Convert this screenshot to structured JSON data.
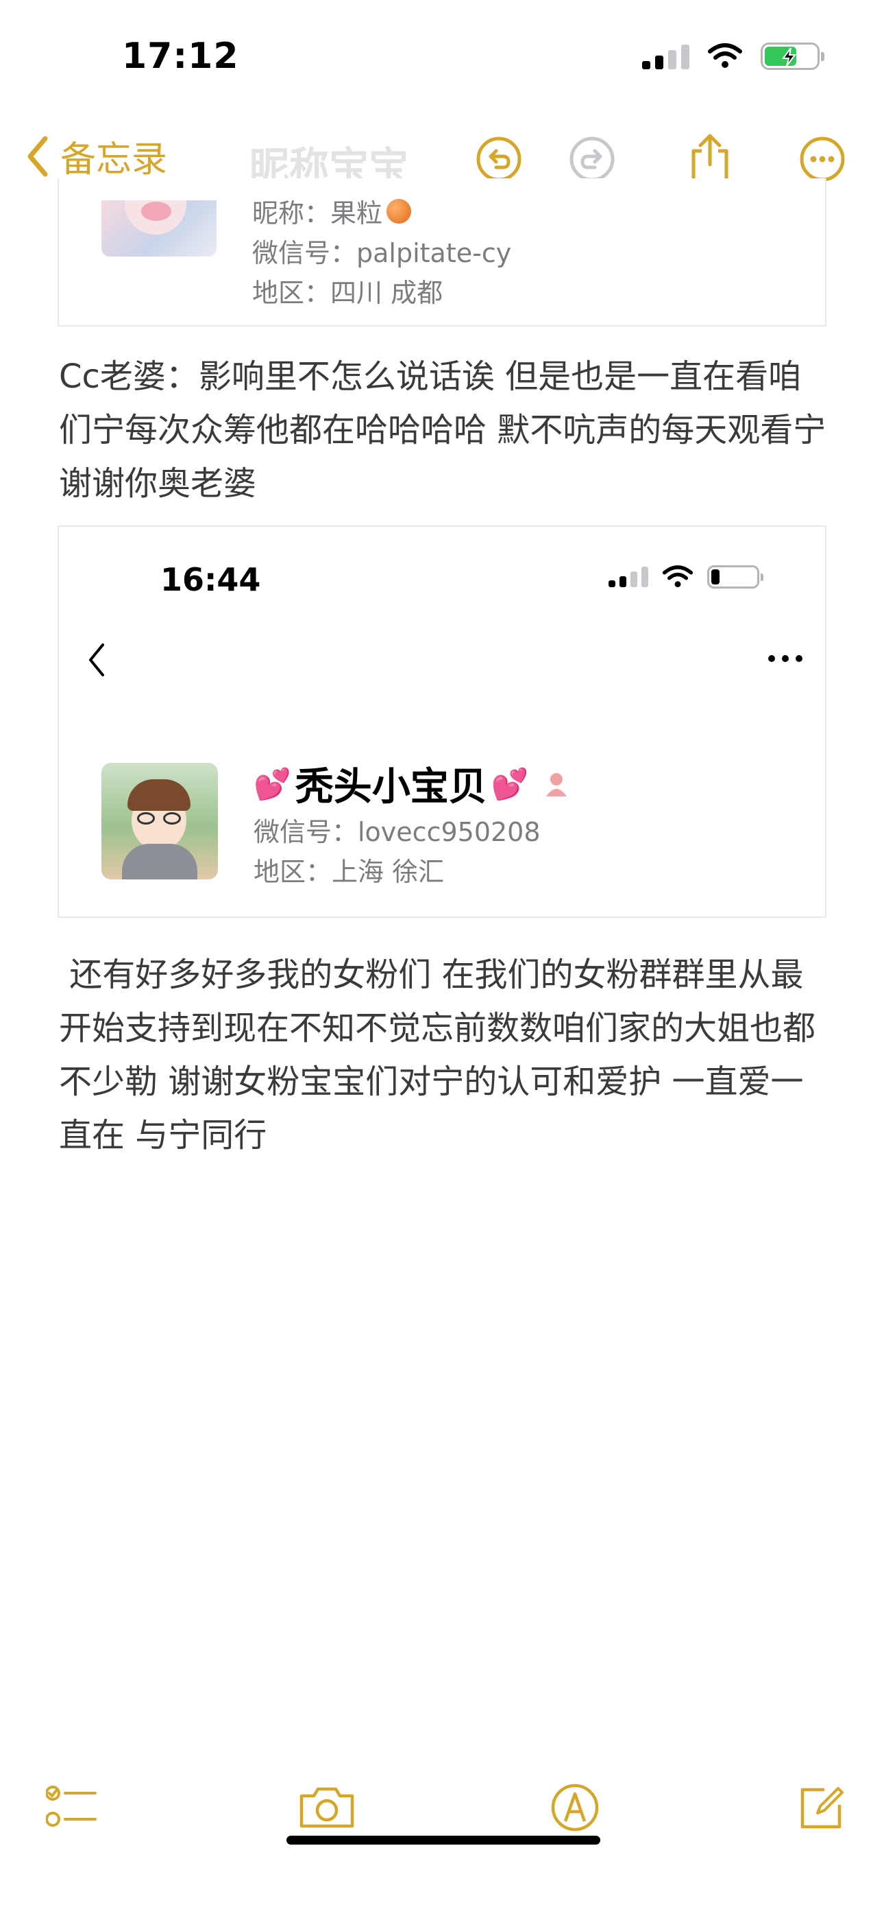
{
  "status_bar": {
    "time": "17:12"
  },
  "nav": {
    "back_label": "备忘录",
    "ghost_title": "昵称宝宝",
    "accent_color": "#d6a62a"
  },
  "card1": {
    "nickname": "昵称：果粒",
    "wechat": "微信号：palpitate-cy",
    "region": "地区：四川 成都"
  },
  "paragraph1": "Cc老婆：影响里不怎么说话诶 但是也是一直在看咱们宁每次众筹他都在哈哈哈哈 默不吭声的每天观看宁 谢谢你奥老婆",
  "card2": {
    "time": "16:44",
    "name": "秃头小宝贝",
    "wechat": "微信号：lovecc950208",
    "region": "地区：上海 徐汇"
  },
  "paragraph2": " 还有好多好多我的女粉们 在我们的女粉群群里从最开始支持到现在不知不觉忘前数数咱们家的大姐也都不少勒 谢谢女粉宝宝们对宁的认可和爱护 一直爱一直在 与宁同行",
  "icons": {
    "undo": "undo-icon",
    "redo": "redo-icon",
    "share": "share-icon",
    "more": "more-icon",
    "checklist": "checklist-icon",
    "camera": "camera-icon",
    "markup": "markup-icon",
    "compose": "compose-icon"
  }
}
